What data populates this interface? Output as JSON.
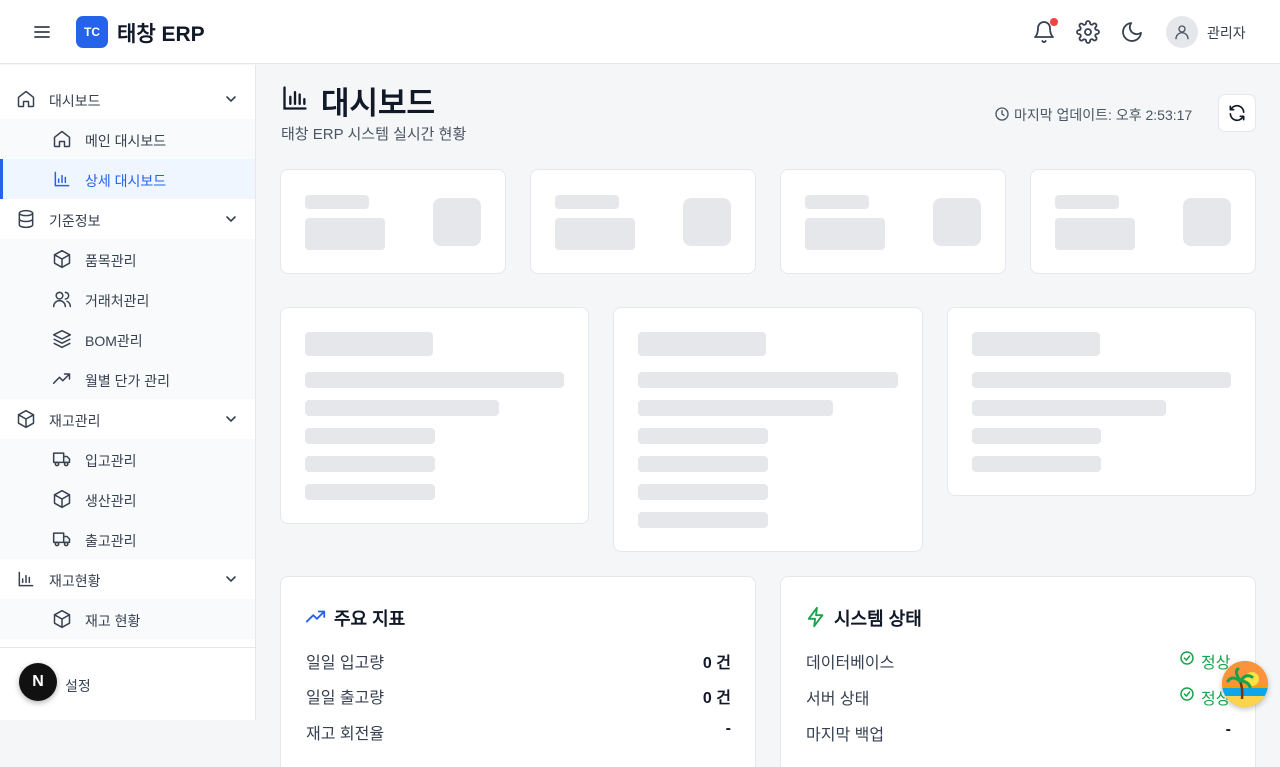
{
  "header": {
    "logo_badge": "TC",
    "app_title": "태창 ERP",
    "user_name": "관리자"
  },
  "sidebar": {
    "groups": [
      {
        "label": "대시보드",
        "items": [
          {
            "label": "메인 대시보드"
          },
          {
            "label": "상세 대시보드",
            "active": true
          }
        ]
      },
      {
        "label": "기준정보",
        "items": [
          {
            "label": "품목관리"
          },
          {
            "label": "거래처관리"
          },
          {
            "label": "BOM관리"
          },
          {
            "label": "월별 단가 관리"
          }
        ]
      },
      {
        "label": "재고관리",
        "items": [
          {
            "label": "입고관리"
          },
          {
            "label": "생산관리"
          },
          {
            "label": "출고관리"
          }
        ]
      },
      {
        "label": "재고현황",
        "items": [
          {
            "label": "재고 현황"
          }
        ]
      }
    ],
    "settings_label": "설정",
    "next_badge": "N"
  },
  "page": {
    "title": "대시보드",
    "subtitle": "태창 ERP 시스템 실시간 현황",
    "last_update": "마지막 업데이트: 오후 2:53:17"
  },
  "kpi_panel": {
    "title": "주요 지표",
    "rows": [
      {
        "label": "일일 입고량",
        "value": "0 건"
      },
      {
        "label": "일일 출고량",
        "value": "0 건"
      },
      {
        "label": "재고 회전율",
        "value": "-"
      }
    ]
  },
  "system_panel": {
    "title": "시스템 상태",
    "rows": [
      {
        "label": "데이터베이스",
        "value": "정상"
      },
      {
        "label": "서버 상태",
        "value": "정상"
      },
      {
        "label": "마지막 백업",
        "value": "-"
      }
    ]
  },
  "colors": {
    "accent": "#2563eb",
    "ok": "#16a34a",
    "alert": "#ef4444"
  }
}
